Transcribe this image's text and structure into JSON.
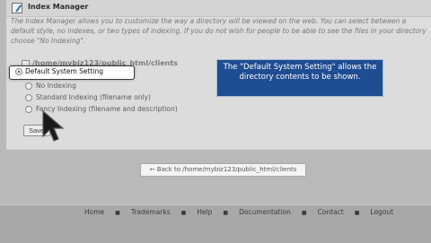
{
  "header": {
    "title": "Index Manager",
    "icon": "index-manager-icon"
  },
  "description": "The Index Manager allows you to customize the way a directory will be viewed on the web. You can select between a default style, no indexes, or two types of indexing. If you do not wish for people to be able to see the files in your directory choose \"No Indexing\".",
  "directory": {
    "path": "/home/mybiz123/public_html/clients"
  },
  "options": [
    {
      "label": "Default System Setting",
      "selected": true
    },
    {
      "label": "No Indexing",
      "selected": false
    },
    {
      "label": "Standard Indexing (filename only)",
      "selected": false
    },
    {
      "label": "Fancy Indexing (filename and description)",
      "selected": false
    }
  ],
  "save_label": "Save",
  "tooltip": "The \"Default System Setting\" allows the directory contents to be shown.",
  "back_link": "← Back to /home/mybiz123/public_html/clients",
  "footer": {
    "links": [
      "Home",
      "Trademarks",
      "Help",
      "Documentation",
      "Contact",
      "Logout"
    ],
    "separator": "■"
  },
  "colors": {
    "tooltip_bg": "#1f4d92",
    "panel_bg": "#dcdcdc",
    "footer_bg": "#a8a8a8"
  }
}
